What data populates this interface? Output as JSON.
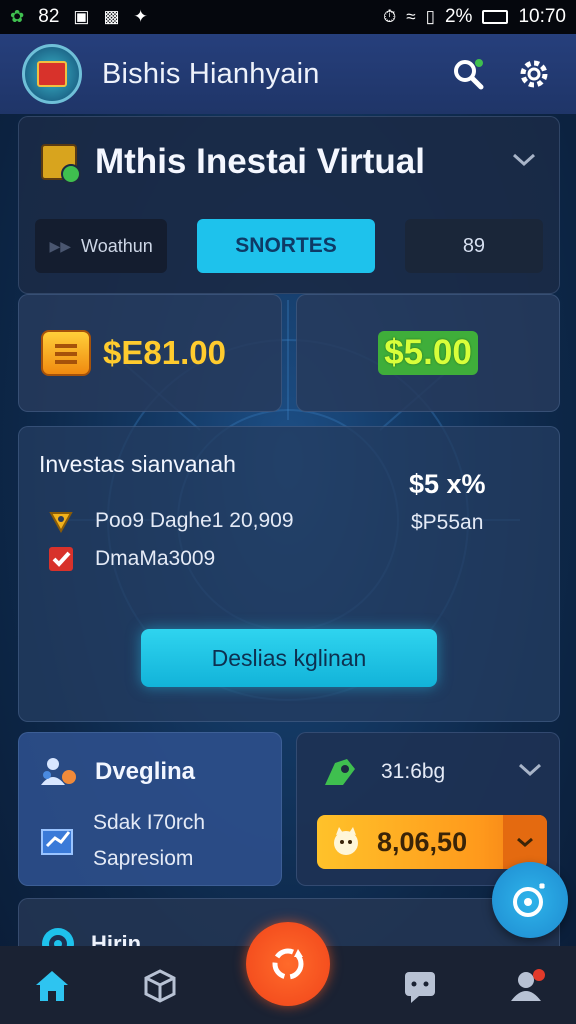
{
  "status_bar": {
    "notif_count": "82",
    "battery": "2%",
    "time": "10:70"
  },
  "app_bar": {
    "title": "Bishis Hianhyain"
  },
  "header": {
    "title": "Mthis Inestai Virtual"
  },
  "tabs": [
    {
      "label": "Woathun"
    },
    {
      "label": "SNORTES"
    },
    {
      "label": "89"
    }
  ],
  "balances": {
    "left_value": "$E81.00",
    "right_value": "$5.00"
  },
  "invest": {
    "title": "Investas sianvanah",
    "percent": "$5 x%",
    "row1_label": "Poo9 Daghe1 20,909",
    "row1_amount": "$P55an",
    "row2_label": "DmaMa3009",
    "cta_label": "Deslias kglinan"
  },
  "mini_left": {
    "title": "Dveglina",
    "line1": "Sdak I70rch",
    "line2": "Sapresiom"
  },
  "mini_right": {
    "label": "31:6bg",
    "select_value": "8,06,50"
  },
  "bottom_card": {
    "title": "Hirin"
  },
  "colors": {
    "accent_cyan": "#1ec2ec",
    "gold": "#ffcb2e",
    "green": "#3fae3a",
    "orange": "#ff9a1c",
    "nav_center": "#f0441a"
  }
}
